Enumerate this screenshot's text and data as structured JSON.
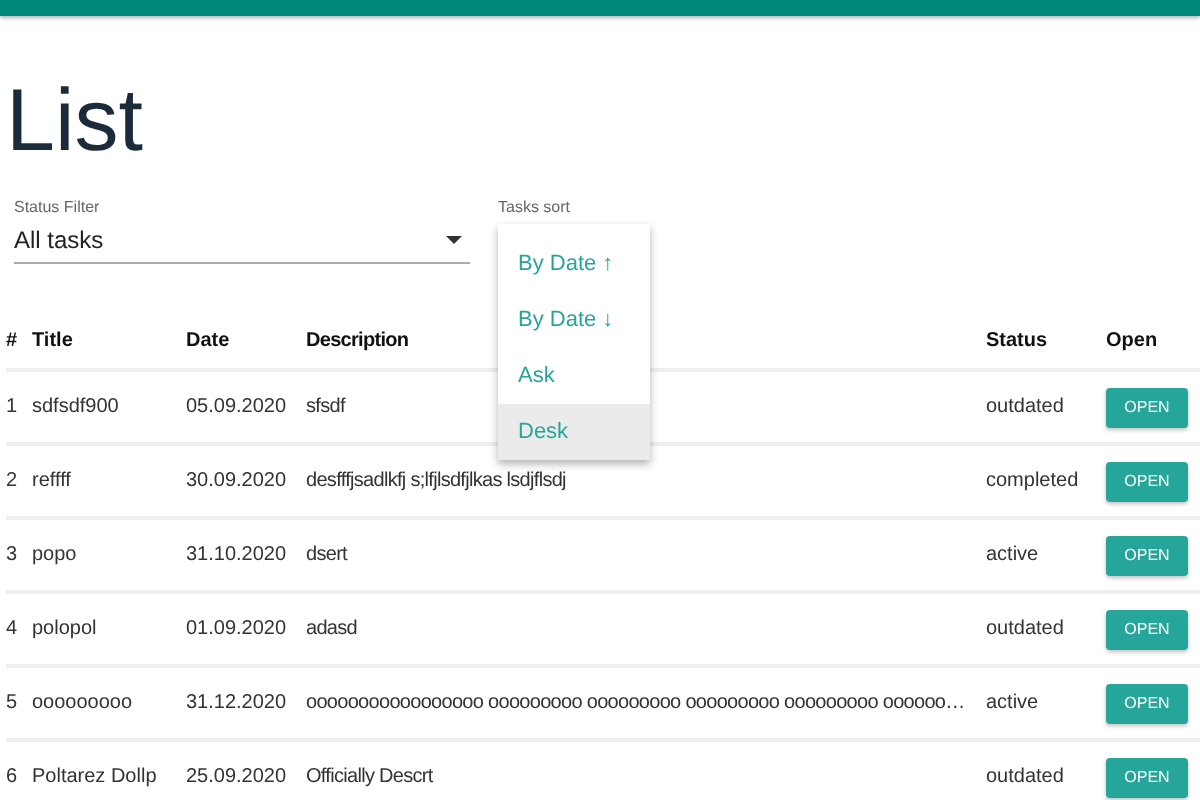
{
  "title": "List",
  "status_filter": {
    "label": "Status Filter",
    "value": "All tasks"
  },
  "tasks_sort": {
    "label": "Tasks sort",
    "options": [
      {
        "label": "By Date ↑",
        "selected": false
      },
      {
        "label": "By Date ↓",
        "selected": false
      },
      {
        "label": "Ask",
        "selected": false
      },
      {
        "label": "Desk",
        "selected": true
      }
    ]
  },
  "table": {
    "columns": [
      "#",
      "Title",
      "Date",
      "Description",
      "Status",
      "Open"
    ],
    "rows": [
      {
        "index": "1",
        "title": "sdfsdf900",
        "date": "05.09.2020",
        "description": "sfsdf",
        "status": "outdated",
        "button": "OPEN"
      },
      {
        "index": "2",
        "title": "reffff",
        "date": "30.09.2020",
        "description": "desfffjsadlkfj s;lfjlsdfjlkas lsdjflsdj",
        "status": "completed",
        "button": "OPEN"
      },
      {
        "index": "3",
        "title": "popo",
        "date": "31.10.2020",
        "description": "dsert",
        "status": "active",
        "button": "OPEN"
      },
      {
        "index": "4",
        "title": "polopol",
        "date": "01.09.2020",
        "description": "adasd",
        "status": "outdated",
        "button": "OPEN"
      },
      {
        "index": "5",
        "title": "ooooooooo",
        "date": "31.12.2020",
        "description": "ooooooooooooooooo ooooooooo ooooooooo ooooooooo ooooooooo oooooo…",
        "status": "active",
        "button": "OPEN"
      },
      {
        "index": "6",
        "title": "Poltarez Dollp",
        "date": "25.09.2020",
        "description": "Officially Descrt",
        "status": "outdated",
        "button": "OPEN"
      }
    ]
  }
}
